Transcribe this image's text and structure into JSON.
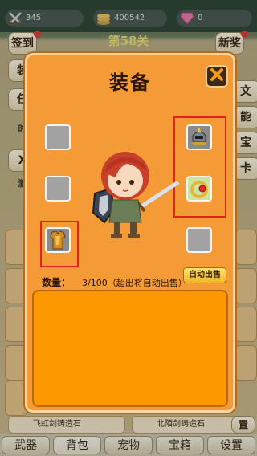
{
  "resources": {
    "swords": "345",
    "coins": "400542",
    "gems": "0"
  },
  "stage": "第58关",
  "side_buttons": {
    "signin": "签到",
    "equip_partial": "装",
    "task_partial": "任",
    "time_partial": "时",
    "x_partial": "X",
    "activate_partial": "激",
    "new_reward": "新奖",
    "right_a": "文",
    "right_b": "能",
    "right_c": "宝",
    "right_d": "卡",
    "right_e": "置"
  },
  "modal": {
    "title": "装备",
    "quantity_label": "数量：",
    "quantity_value": "3/100（超出将自动出售）",
    "auto_sell_label": "自动出售"
  },
  "bottom_items": [
    {
      "label": "飞虹剑铸造石"
    },
    {
      "label": "北陌剑铸造石"
    }
  ],
  "tabs": [
    {
      "label": "武器"
    },
    {
      "label": "背包"
    },
    {
      "label": "宠物"
    },
    {
      "label": "宝箱"
    },
    {
      "label": "设置"
    }
  ],
  "colors": {
    "modal_bg": "#f49a36",
    "highlight": "#e3221c",
    "pane": "#fe9800"
  }
}
